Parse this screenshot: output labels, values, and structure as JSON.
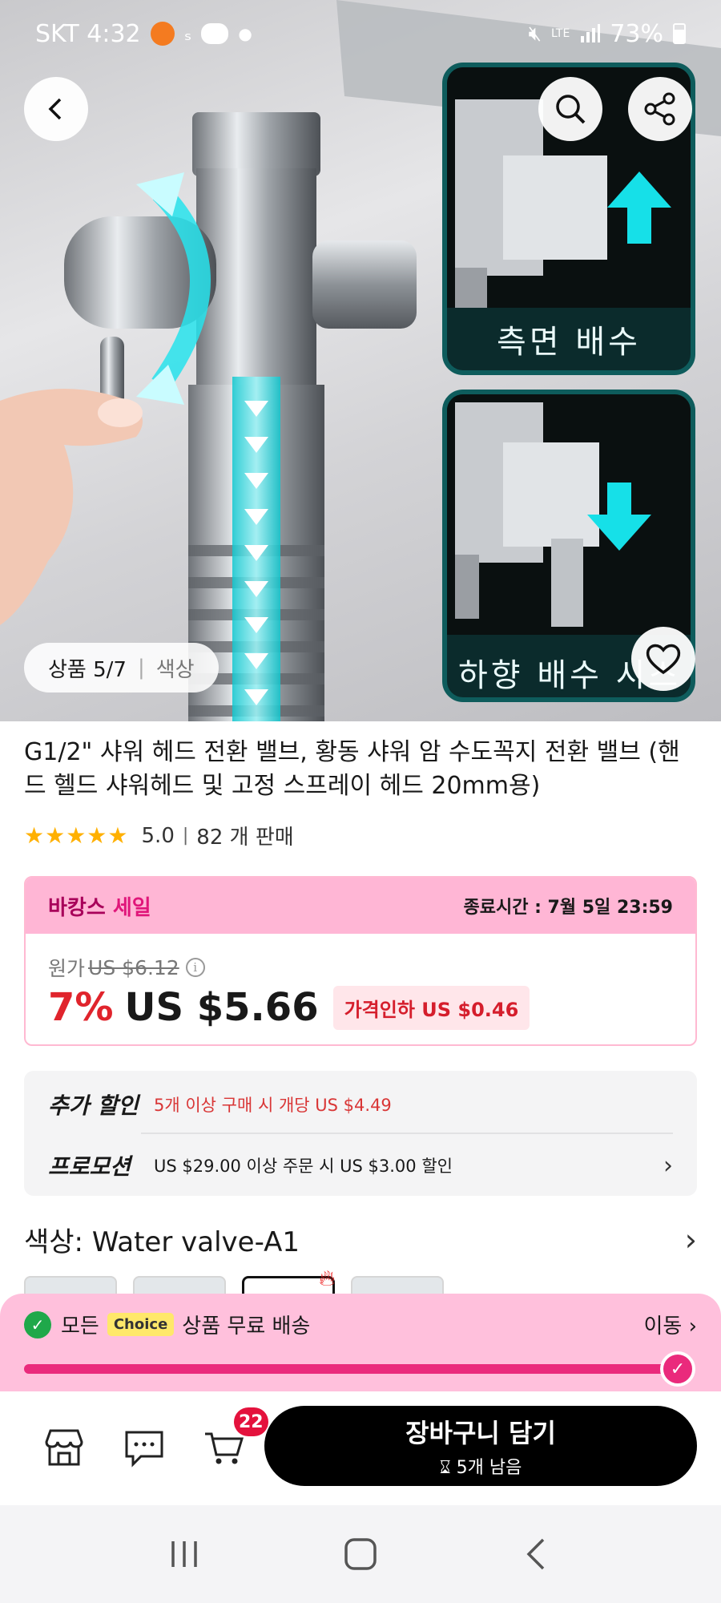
{
  "status_bar": {
    "carrier_time": "SKT 4:32",
    "network": "LTE",
    "battery": "73%"
  },
  "hero": {
    "panel_top_label": "측면 배수",
    "panel_bottom_label": "하향 배수 시스",
    "pill_counter": "상품 5/7",
    "pill_tab": "색상"
  },
  "product": {
    "title": "G1/2\" 샤워 헤드 전환 밸브, 황동 샤워 암 수도꼭지 전환 밸브 (핸드 헬드 샤워헤드 및 고정 스프레이 헤드 20mm용)",
    "rating": "5.0",
    "sold": "82 개 판매"
  },
  "sale": {
    "name_part1": "바캉스",
    "name_part2": "세일",
    "end_time": "종료시간 :  7월 5일 23:59",
    "original_label": "원가",
    "original_price": "US $6.12",
    "discount": "7%",
    "price": "US $5.66",
    "drop_tag": "가격인하 US $0.46"
  },
  "promotions": [
    {
      "key": "추가 할인",
      "value": "5개 이상 구매 시 개당 US $4.49"
    },
    {
      "key": "프로모션",
      "value": "US $29.00 이상 주문 시 US $3.00 할인"
    }
  ],
  "color": {
    "label": "색상: Water valve-A1"
  },
  "choice_banner": {
    "prefix": "모든",
    "chip": "Choice",
    "text": "상품 무료 배송",
    "go": "이동",
    "progress": 1.0
  },
  "action_bar": {
    "cart_count": "22",
    "buy_label": "장바구니 담기",
    "buy_sub": "5개 남음"
  },
  "colors": {
    "accent": "#ea2a7c",
    "price_red": "#e0242c",
    "star": "#ffb000"
  }
}
